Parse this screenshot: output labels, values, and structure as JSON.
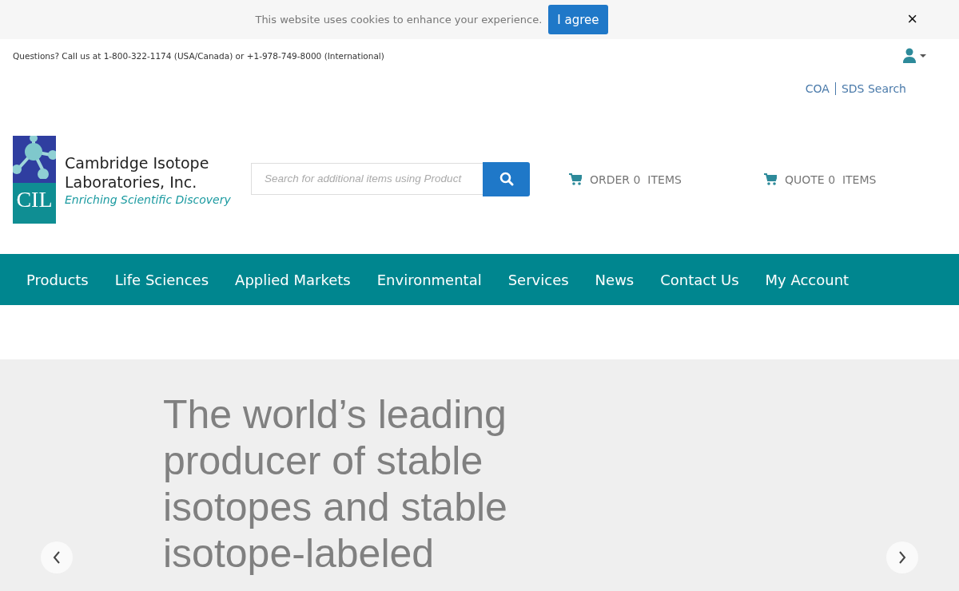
{
  "cookie_bar": {
    "message": "This website uses cookies to enhance your experience.",
    "button": "I agree",
    "close": "×"
  },
  "top_bar": {
    "phone_text": "Questions? Call us at 1-800-322-1174 (USA/Canada) or +1-978-749-8000 (International)"
  },
  "utility_links": [
    "COA",
    "SDS Search"
  ],
  "logo": {
    "mark": "CIL",
    "name_lines": [
      "Cambridge Isotope",
      "Laboratories, Inc."
    ],
    "tagline": "Enriching Scientific Discovery"
  },
  "search": {
    "placeholder": "Search for additional items using Product"
  },
  "carts": [
    {
      "label": "ORDER",
      "count": "0",
      "unit": "ITEMS"
    },
    {
      "label": "QUOTE",
      "count": "0",
      "unit": "ITEMS"
    }
  ],
  "nav": [
    "Products",
    "Life Sciences",
    "Applied Markets",
    "Environmental",
    "Services",
    "News",
    "Contact Us",
    "My Account"
  ],
  "hero": {
    "headline_lines": [
      "The world’s leading",
      "producer of stable",
      "isotopes and stable",
      "isotope-labeled"
    ]
  }
}
